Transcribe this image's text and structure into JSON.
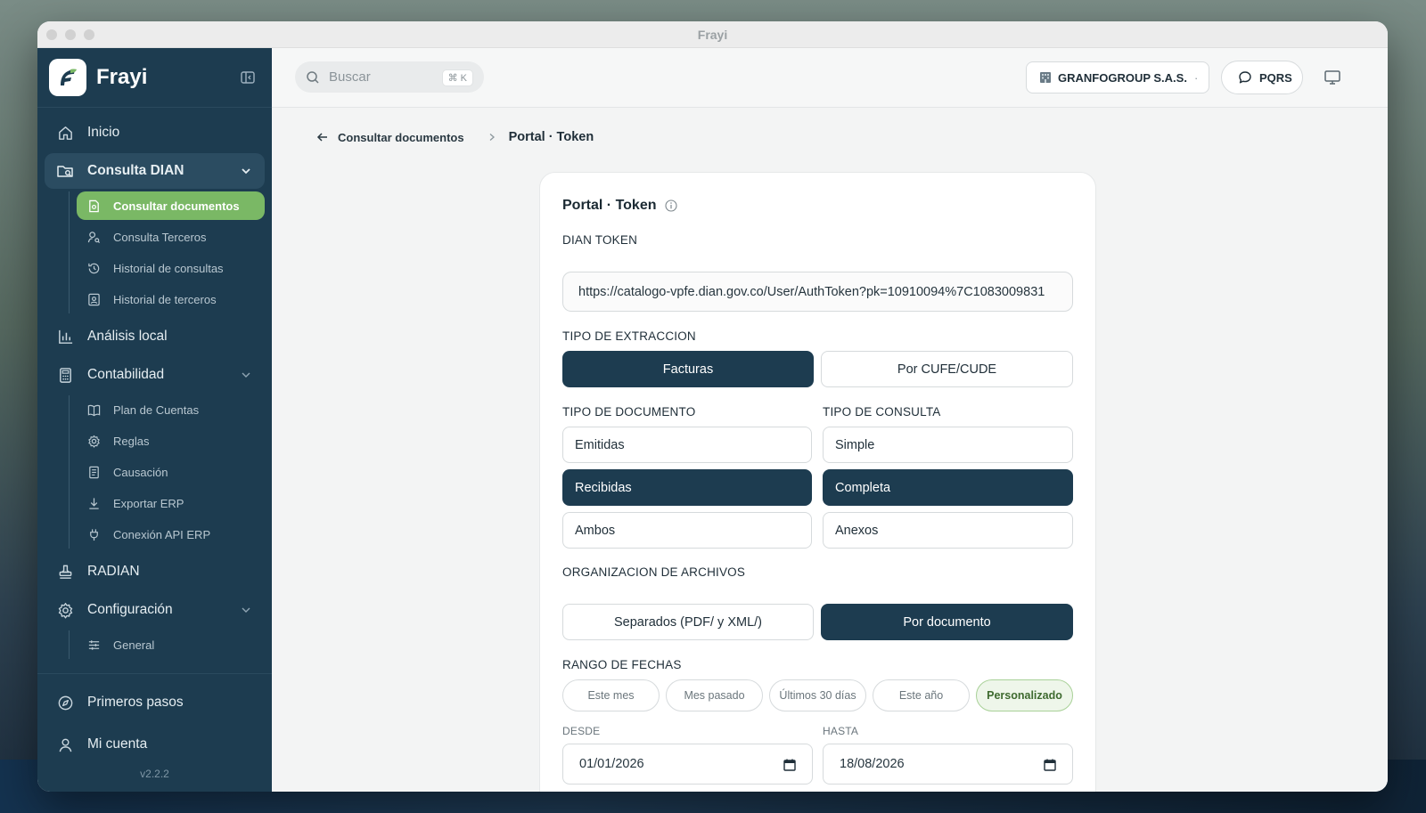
{
  "window": {
    "title": "Frayi"
  },
  "sidebar": {
    "brand": "Frayi",
    "items": [
      {
        "label": "Inicio"
      },
      {
        "label": "Consulta DIAN"
      },
      {
        "label": "Análisis local"
      },
      {
        "label": "Contabilidad"
      },
      {
        "label": "RADIAN"
      },
      {
        "label": "Configuración"
      }
    ],
    "consulta_sub": [
      {
        "label": "Consultar documentos"
      },
      {
        "label": "Consulta Terceros"
      },
      {
        "label": "Historial de consultas"
      },
      {
        "label": "Historial de terceros"
      }
    ],
    "contabilidad_sub": [
      {
        "label": "Plan de Cuentas"
      },
      {
        "label": "Reglas"
      },
      {
        "label": "Causación"
      },
      {
        "label": "Exportar ERP"
      },
      {
        "label": "Conexión API ERP"
      }
    ],
    "config_sub": [
      {
        "label": "General"
      }
    ],
    "footer": [
      {
        "label": "Primeros pasos"
      },
      {
        "label": "Mi cuenta"
      }
    ],
    "version": "v2.2.2"
  },
  "topbar": {
    "search_placeholder": "Buscar",
    "shortcut": "⌘ K",
    "company": "GRANFOGROUP S.A.S.",
    "pqrs": "PQRS"
  },
  "breadcrumb": {
    "back": "Consultar documentos",
    "current": "Portal · Token"
  },
  "form": {
    "title": "Portal · Token",
    "token_label": "DIAN TOKEN",
    "token_value": "https://catalogo-vpfe.dian.gov.co/User/AuthToken?pk=10910094%7C1083009831",
    "extraccion_label": "TIPO DE EXTRACCION",
    "extraccion_options": [
      "Facturas",
      "Por CUFE/CUDE"
    ],
    "documento_label": "TIPO DE DOCUMENTO",
    "documento_options": [
      "Emitidas",
      "Recibidas",
      "Ambos"
    ],
    "consulta_label": "TIPO DE CONSULTA",
    "consulta_options": [
      "Simple",
      "Completa",
      "Anexos"
    ],
    "organizacion_label": "ORGANIZACION DE ARCHIVOS",
    "organizacion_options": [
      "Separados (PDF/ y XML/)",
      "Por documento"
    ],
    "rango_label": "RANGO DE FECHAS",
    "rango_options": [
      "Este mes",
      "Mes pasado",
      "Últimos 30 días",
      "Este año",
      "Personalizado"
    ],
    "desde_label": "DESDE",
    "desde_value": "01/01/2026",
    "hasta_label": "HASTA",
    "hasta_value": "18/08/2026"
  },
  "colors": {
    "sidebar": "#1d3c50",
    "accent_green": "#7ab865",
    "selected": "#1d3c50"
  }
}
